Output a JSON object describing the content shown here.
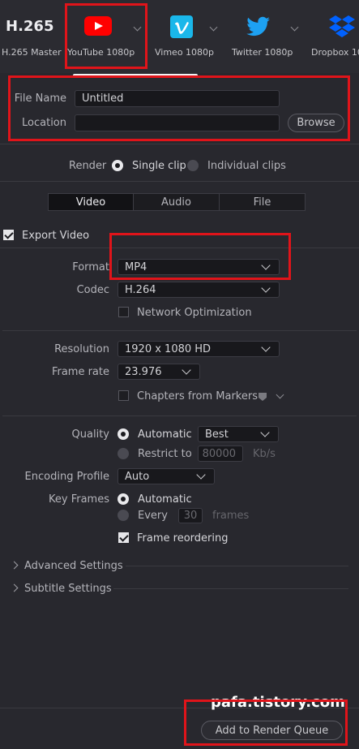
{
  "presets": [
    {
      "title": "H.265",
      "label": "H.265 Master"
    },
    {
      "label": "YouTube 1080p",
      "icon": "youtube-icon"
    },
    {
      "label": "Vimeo 1080p",
      "icon": "vimeo-icon"
    },
    {
      "label": "Twitter 1080p",
      "icon": "twitter-icon"
    },
    {
      "label": "Dropbox 10",
      "icon": "dropbox-icon"
    }
  ],
  "file": {
    "name_label": "File Name",
    "name_value": "Untitled",
    "location_label": "Location",
    "location_value": "",
    "browse": "Browse"
  },
  "render": {
    "label": "Render",
    "single": "Single clip",
    "individual": "Individual clips"
  },
  "tabs": [
    "Video",
    "Audio",
    "File"
  ],
  "export_video": "Export Video",
  "format": {
    "label": "Format",
    "value": "MP4"
  },
  "codec": {
    "label": "Codec",
    "value": "H.264"
  },
  "network_opt": "Network Optimization",
  "resolution": {
    "label": "Resolution",
    "value": "1920 x 1080 HD"
  },
  "frame_rate": {
    "label": "Frame rate",
    "value": "23.976"
  },
  "chapters": "Chapters from Markers",
  "quality": {
    "label": "Quality",
    "automatic": "Automatic",
    "best": "Best",
    "restrict": "Restrict to",
    "restrict_value": "80000",
    "unit": "Kb/s"
  },
  "encoding_profile": {
    "label": "Encoding Profile",
    "value": "Auto"
  },
  "key_frames": {
    "label": "Key Frames",
    "automatic": "Automatic",
    "every": "Every",
    "every_value": "30",
    "unit": "frames"
  },
  "frame_reordering": "Frame reordering",
  "advanced": "Advanced Settings",
  "subtitle": "Subtitle Settings",
  "watermark": "pafa.tistory.com",
  "add_queue": "Add to Render Queue",
  "colors": {
    "accent_red": "#e0141a",
    "youtube": "#ff0000",
    "vimeo": "#1ab7ea",
    "twitter": "#1da1f2",
    "dropbox": "#0061fe"
  }
}
